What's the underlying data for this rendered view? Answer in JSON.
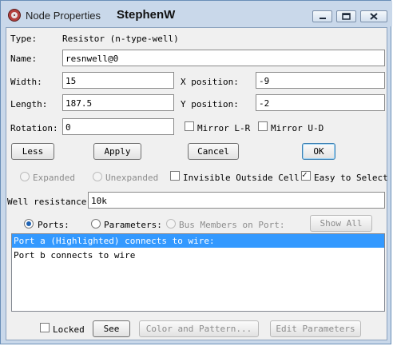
{
  "window": {
    "title": "Node Properties",
    "user": "StephenW"
  },
  "type_row": {
    "label": "Type:",
    "value": "Resistor (n-type-well)"
  },
  "name_row": {
    "label": "Name:",
    "value": "resnwell@0"
  },
  "width_row": {
    "label": "Width:",
    "value": "15"
  },
  "length_row": {
    "label": "Length:",
    "value": "187.5"
  },
  "rotation_row": {
    "label": "Rotation:",
    "value": "0"
  },
  "xpos": {
    "label": "X position:",
    "value": "-9"
  },
  "ypos": {
    "label": "Y position:",
    "value": "-2"
  },
  "mirror_lr": {
    "label": "Mirror L-R",
    "checked": false
  },
  "mirror_ud": {
    "label": "Mirror U-D",
    "checked": false
  },
  "buttons": {
    "less": "Less",
    "apply": "Apply",
    "cancel": "Cancel",
    "ok": "OK",
    "show_all": "Show All",
    "see": "See",
    "color_pattern": "Color and Pattern...",
    "edit_params": "Edit Parameters"
  },
  "expand": {
    "expanded": "Expanded",
    "unexpanded": "Unexpanded",
    "invisible": "Invisible Outside Cell",
    "easy_select": "Easy to Select"
  },
  "well": {
    "label": "Well resistance:",
    "value": "10k"
  },
  "list_mode": {
    "ports": "Ports:",
    "parameters": "Parameters:",
    "bus_members": "Bus Members on Port:"
  },
  "ports_list": [
    "Port a (Highlighted) connects to wire:",
    "Port b connects to wire"
  ],
  "locked": {
    "label": "Locked",
    "checked": false
  }
}
